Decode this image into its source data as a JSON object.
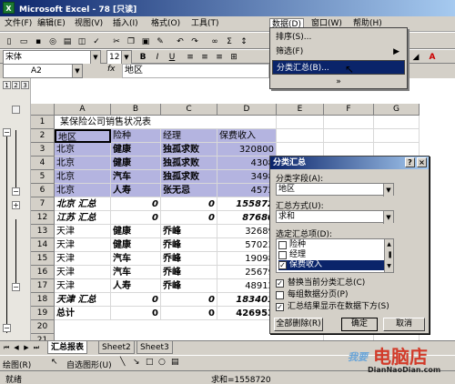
{
  "titlebar": {
    "icon": "excel-logo-icon",
    "title": "Microsoft Excel - 78 [只读]"
  },
  "menubar": {
    "items": [
      "文件(F)",
      "编辑(E)",
      "视图(V)",
      "插入(I)",
      "格式(O)",
      "工具(T)",
      "数据(D)",
      "窗口(W)",
      "帮助(H)"
    ]
  },
  "formatting": {
    "font": "宋体",
    "size": "12"
  },
  "formula": {
    "name_box": "A2",
    "fx": "fx",
    "content": "地区"
  },
  "outline": {
    "levels": [
      "1",
      "2",
      "3"
    ]
  },
  "columns": [
    "A",
    "B",
    "C",
    "D",
    "E",
    "F",
    "G"
  ],
  "sheet": {
    "title": "某保险公司销售状况表",
    "headers": [
      "地区",
      "险种",
      "经理",
      "保费收入"
    ],
    "rows": [
      {
        "n": "1"
      },
      {
        "n": "2"
      },
      {
        "n": "3",
        "a": "北京",
        "b": "健康",
        "c": "独孤求败",
        "d": "320800"
      },
      {
        "n": "4",
        "a": "北京",
        "b": "健康",
        "c": "独孤求败",
        "d": "4308"
      },
      {
        "n": "5",
        "a": "北京",
        "b": "汽车",
        "c": "独孤求败",
        "d": "3498"
      },
      {
        "n": "6",
        "a": "北京",
        "b": "人寿",
        "c": "张无忌",
        "d": "4572"
      },
      {
        "n": "7",
        "a": "北京 汇总",
        "b": "0",
        "c": "0",
        "d": "155872"
      },
      {
        "n": "12",
        "a": "江苏 汇总",
        "b": "0",
        "c": "0",
        "d": "87680"
      },
      {
        "n": "13",
        "a": "天津",
        "b": "健康",
        "c": "乔峰",
        "d": "32689"
      },
      {
        "n": "14",
        "a": "天津",
        "b": "健康",
        "c": "乔峰",
        "d": "57023"
      },
      {
        "n": "15",
        "a": "天津",
        "b": "汽车",
        "c": "乔峰",
        "d": "19098"
      },
      {
        "n": "16",
        "a": "天津",
        "b": "汽车",
        "c": "乔峰",
        "d": "25679"
      },
      {
        "n": "17",
        "a": "天津",
        "b": "人寿",
        "c": "乔峰",
        "d": "48912"
      },
      {
        "n": "18",
        "a": "天津 汇总",
        "b": "0",
        "c": "0",
        "d": "183401"
      },
      {
        "n": "19",
        "a": "总计",
        "b": "0",
        "c": "0",
        "d": "426953"
      },
      {
        "n": "20"
      },
      {
        "n": "21"
      },
      {
        "n": "22"
      }
    ]
  },
  "tabs": [
    "汇总报表",
    "Sheet2",
    "Sheet3"
  ],
  "drawbar": {
    "draw": "绘图(R)",
    "autoshapes": "自选图形(U)"
  },
  "status": {
    "left": "就绪",
    "sum": "求和=1558720"
  },
  "data_menu": {
    "items": [
      "排序(S)...",
      "筛选(F)",
      "分类汇总(B)...",
      "»"
    ]
  },
  "dialog": {
    "title": "分类汇总",
    "group_label": "分类字段(A):",
    "group_value": "地区",
    "func_label": "汇总方式(U):",
    "func_value": "求和",
    "items_label": "选定汇总项(D):",
    "items": [
      {
        "label": "险种",
        "checked": false
      },
      {
        "label": "经理",
        "checked": false
      },
      {
        "label": "保费收入",
        "checked": true
      }
    ],
    "options": [
      {
        "label": "替换当前分类汇总(C)",
        "checked": true
      },
      {
        "label": "每组数据分页(P)",
        "checked": false
      },
      {
        "label": "汇总结果显示在数据下方(S)",
        "checked": true
      }
    ],
    "btn_remove": "全部删除(R)",
    "btn_ok": "确定",
    "btn_cancel": "取消"
  },
  "watermark": {
    "line1": "我要",
    "line2": "电脑店",
    "line3": "DianNaoDian.com"
  },
  "colors": {
    "title_start": "#0a246a",
    "title_end": "#a6caf0",
    "highlight": "#b4b4e0",
    "watermark": "#d23b2a"
  }
}
